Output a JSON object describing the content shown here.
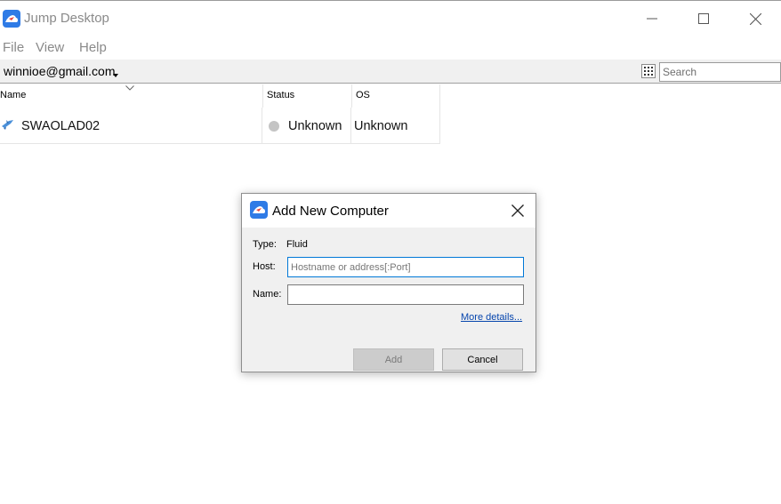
{
  "window": {
    "title": "Jump Desktop",
    "icon": "jump-desktop-logo-icon",
    "controls": [
      "minimize-icon",
      "maximize-icon",
      "close-icon"
    ]
  },
  "menu": {
    "file": "File",
    "view": "View",
    "help": "Help"
  },
  "toolbar": {
    "account": "winnioe@gmail.com",
    "grid_icon": "grid-view-icon",
    "search_placeholder": "Search"
  },
  "list": {
    "columns": [
      "Name",
      "Status",
      "OS"
    ],
    "rows": [
      {
        "name": "SWAOLAD02",
        "status": "Unknown",
        "os": "Unknown",
        "icon": "computer-icon",
        "status_color": "#c4c4c4"
      }
    ]
  },
  "dialog": {
    "title": "Add New Computer",
    "type_label": "Type:",
    "type_value": "Fluid",
    "host_label": "Host:",
    "host_value": "",
    "host_placeholder": "Hostname or address[:Port]",
    "name_label": "Name:",
    "name_value": "",
    "more_details": "More details...",
    "add_label": "Add",
    "cancel_label": "Cancel"
  },
  "colors": {
    "accent": "#0078d7",
    "link": "#0645ad",
    "app_icon": "#2f7be6"
  }
}
